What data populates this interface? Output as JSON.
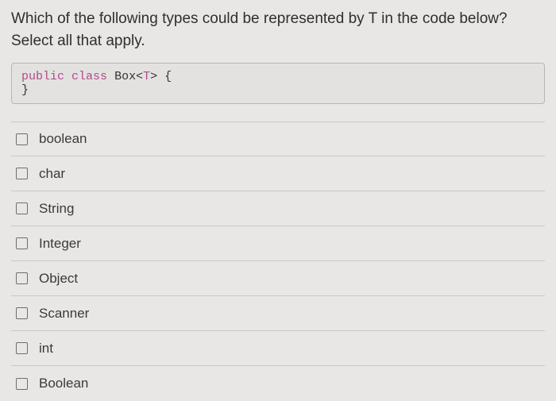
{
  "question": {
    "prompt": "Which of the following types could be represented by T in the code below? Select all that apply."
  },
  "code": {
    "kw_public": "public",
    "kw_class": "class",
    "name": "Box",
    "generic_open": "<",
    "generic_param": "T",
    "generic_close": ">",
    "brace_open": "{",
    "brace_close": "}"
  },
  "options": [
    {
      "label": "boolean",
      "checked": false
    },
    {
      "label": "char",
      "checked": false
    },
    {
      "label": "String",
      "checked": false
    },
    {
      "label": "Integer",
      "checked": false
    },
    {
      "label": "Object",
      "checked": false
    },
    {
      "label": "Scanner",
      "checked": false
    },
    {
      "label": "int",
      "checked": false
    },
    {
      "label": "Boolean",
      "checked": false
    }
  ]
}
